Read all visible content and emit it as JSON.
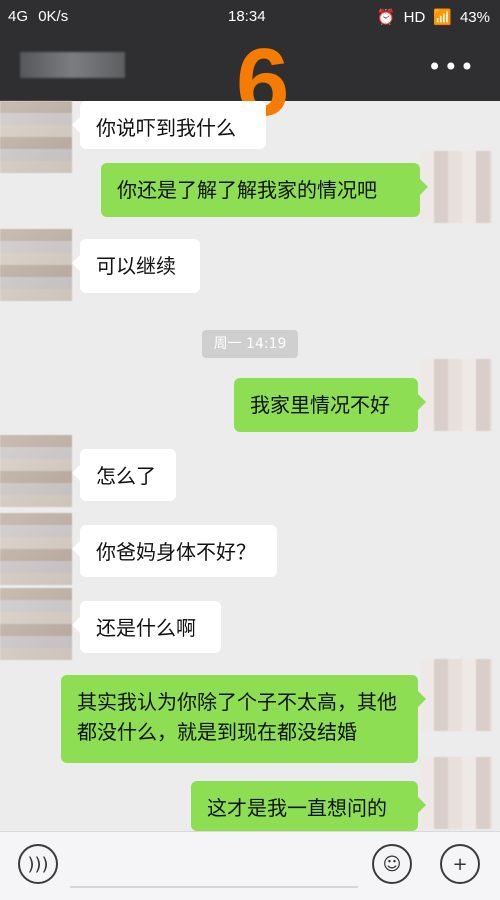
{
  "statusbar": {
    "signal": "4G",
    "speed": "0K/s",
    "time": "18:34",
    "right_text": "HD",
    "battery": "43%"
  },
  "header": {
    "menu_icon": "more-icon",
    "badge": "6"
  },
  "messages": [
    {
      "side": "left",
      "text": "你说吓到我什么"
    },
    {
      "side": "right",
      "text": "你还是了解了解我家的情况吧"
    },
    {
      "side": "left",
      "text": "可以继续"
    },
    {
      "side": "right",
      "text": "我家里情况不好"
    },
    {
      "side": "left",
      "text": "怎么了"
    },
    {
      "side": "left",
      "text": "你爸妈身体不好？"
    },
    {
      "side": "left",
      "text": "还是什么啊"
    },
    {
      "side": "right",
      "text": "其实我认为你除了个子不太高，其他都没什么，就是到现在都没结婚"
    },
    {
      "side": "right",
      "text": "这才是我一直想问的"
    }
  ],
  "timestamp": "周一 14:19",
  "inputbar": {
    "voice_icon": "voice-icon",
    "emoji_icon": "emoji-icon",
    "plus_icon": "plus-icon"
  },
  "colors": {
    "statusbar": "#2f2f31",
    "chat_bg": "#ececec",
    "bubble_left": "#ffffff",
    "bubble_right": "#8dde53",
    "badge": "#f57c00"
  }
}
